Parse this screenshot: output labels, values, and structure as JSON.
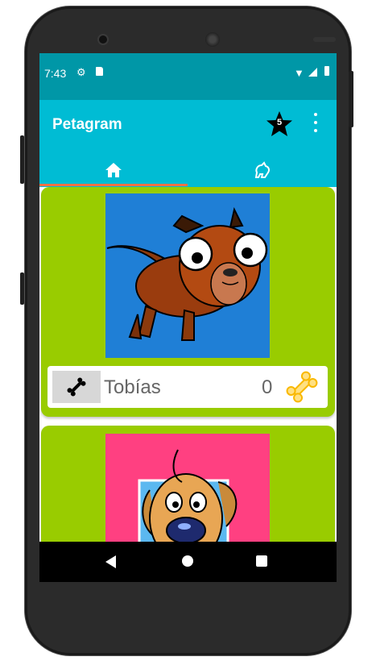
{
  "status_bar": {
    "time": "7:43"
  },
  "app_bar": {
    "title": "Petagram",
    "favorites_count": "5"
  },
  "tabs": [
    {
      "name": "home"
    },
    {
      "name": "pet"
    }
  ],
  "pets": [
    {
      "name": "Tobías",
      "likes": "0"
    }
  ],
  "colors": {
    "accent": "#00bcd4",
    "status": "#0097a7",
    "card": "#99cc00",
    "indicator": "#ff7043"
  },
  "icons": [
    "gear-icon",
    "sd-card-icon",
    "wifi-icon",
    "signal-icon",
    "battery-icon",
    "star-icon",
    "more-vert-icon",
    "home-icon",
    "dog-icon",
    "bone-icon",
    "back-icon",
    "circle-home-icon",
    "recents-icon"
  ]
}
